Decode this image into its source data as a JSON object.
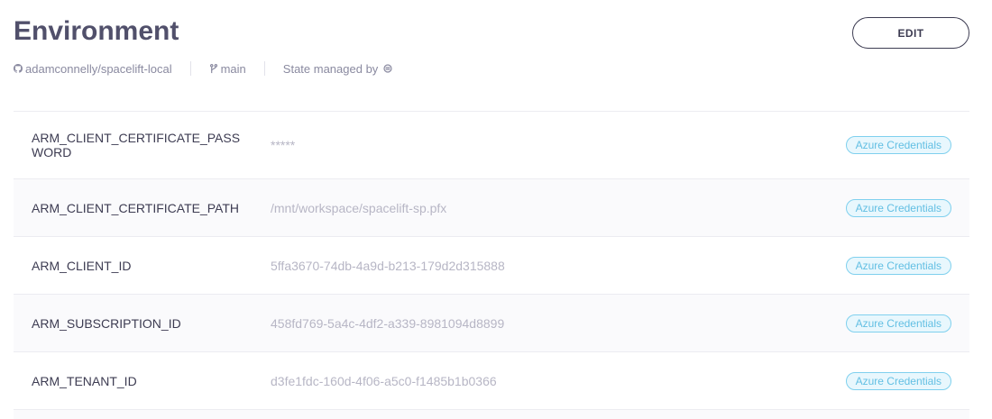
{
  "header": {
    "title": "Environment",
    "edit_label": "EDIT"
  },
  "meta": {
    "repo_icon": "github-icon",
    "repo": "adamconnelly/spacelift-local",
    "branch_icon": "git-branch-icon",
    "branch": "main",
    "state_label": "State managed by",
    "state_icon": "spacelift-logo-icon"
  },
  "variables": [
    {
      "name": "ARM_CLIENT_CERTIFICATE_PASSWORD",
      "value": "*****",
      "context": "Azure Credentials"
    },
    {
      "name": "ARM_CLIENT_CERTIFICATE_PATH",
      "value": "/mnt/workspace/spacelift-sp.pfx",
      "context": "Azure Credentials"
    },
    {
      "name": "ARM_CLIENT_ID",
      "value": "5ffa3670-74db-4a9d-b213-179d2d315888",
      "context": "Azure Credentials"
    },
    {
      "name": "ARM_SUBSCRIPTION_ID",
      "value": "458fd769-5a4c-4df2-a339-8981094d8899",
      "context": "Azure Credentials"
    },
    {
      "name": "ARM_TENANT_ID",
      "value": "d3fe1fdc-160d-4f06-a5c0-f1485b1b0366",
      "context": "Azure Credentials"
    }
  ],
  "colors": {
    "title": "#51506b",
    "badge_border": "#7fd0ee",
    "badge_text": "#62bfe3",
    "value_text": "#b7b6c5"
  }
}
